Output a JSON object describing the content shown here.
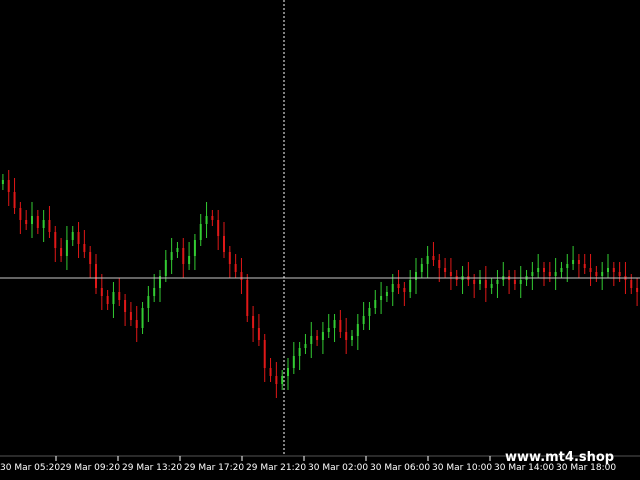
{
  "watermark": "www.mt4.shop",
  "colors": {
    "background": "#000000",
    "bull": "#33cc33",
    "bear": "#e01818",
    "grid": "#c8c8c8",
    "text": "#ffffff"
  },
  "time_axis": {
    "labels": [
      "30 Mar 05:20",
      "29 Mar 09:20",
      "29 Mar 13:20",
      "29 Mar 17:20",
      "29 Mar 21:20",
      "30 Mar 02:00",
      "30 Mar 06:00",
      "30 Mar 10:00",
      "30 Mar 14:00",
      "30 Mar 18:00"
    ]
  },
  "chart_data": {
    "type": "candlestick",
    "title": "",
    "xlabel": "",
    "ylabel": "",
    "ylim": [
      0,
      100
    ],
    "grid": "crosshair",
    "values": [
      65,
      62,
      58,
      55,
      54,
      56,
      53,
      55,
      52,
      48,
      46,
      50,
      52,
      49,
      47,
      44,
      38,
      36,
      34,
      37,
      35,
      32,
      30,
      28,
      33,
      36,
      38,
      41,
      45,
      47,
      48,
      44,
      46,
      50,
      54,
      56,
      55,
      51,
      47,
      44,
      42,
      40,
      31,
      28,
      25,
      18,
      16,
      14,
      16,
      18,
      21,
      23,
      24,
      26,
      25,
      27,
      28,
      30,
      27,
      25,
      26,
      29,
      31,
      33,
      35,
      36,
      37,
      39,
      38,
      37,
      40,
      42,
      44,
      46,
      45,
      43,
      42,
      41,
      40,
      41,
      40,
      39,
      40,
      38,
      39,
      40,
      41,
      40,
      39,
      40,
      41,
      42,
      43,
      42,
      41,
      42,
      43,
      44,
      45,
      44,
      43,
      42,
      41,
      42,
      43,
      42,
      41,
      40,
      38,
      37
    ]
  }
}
